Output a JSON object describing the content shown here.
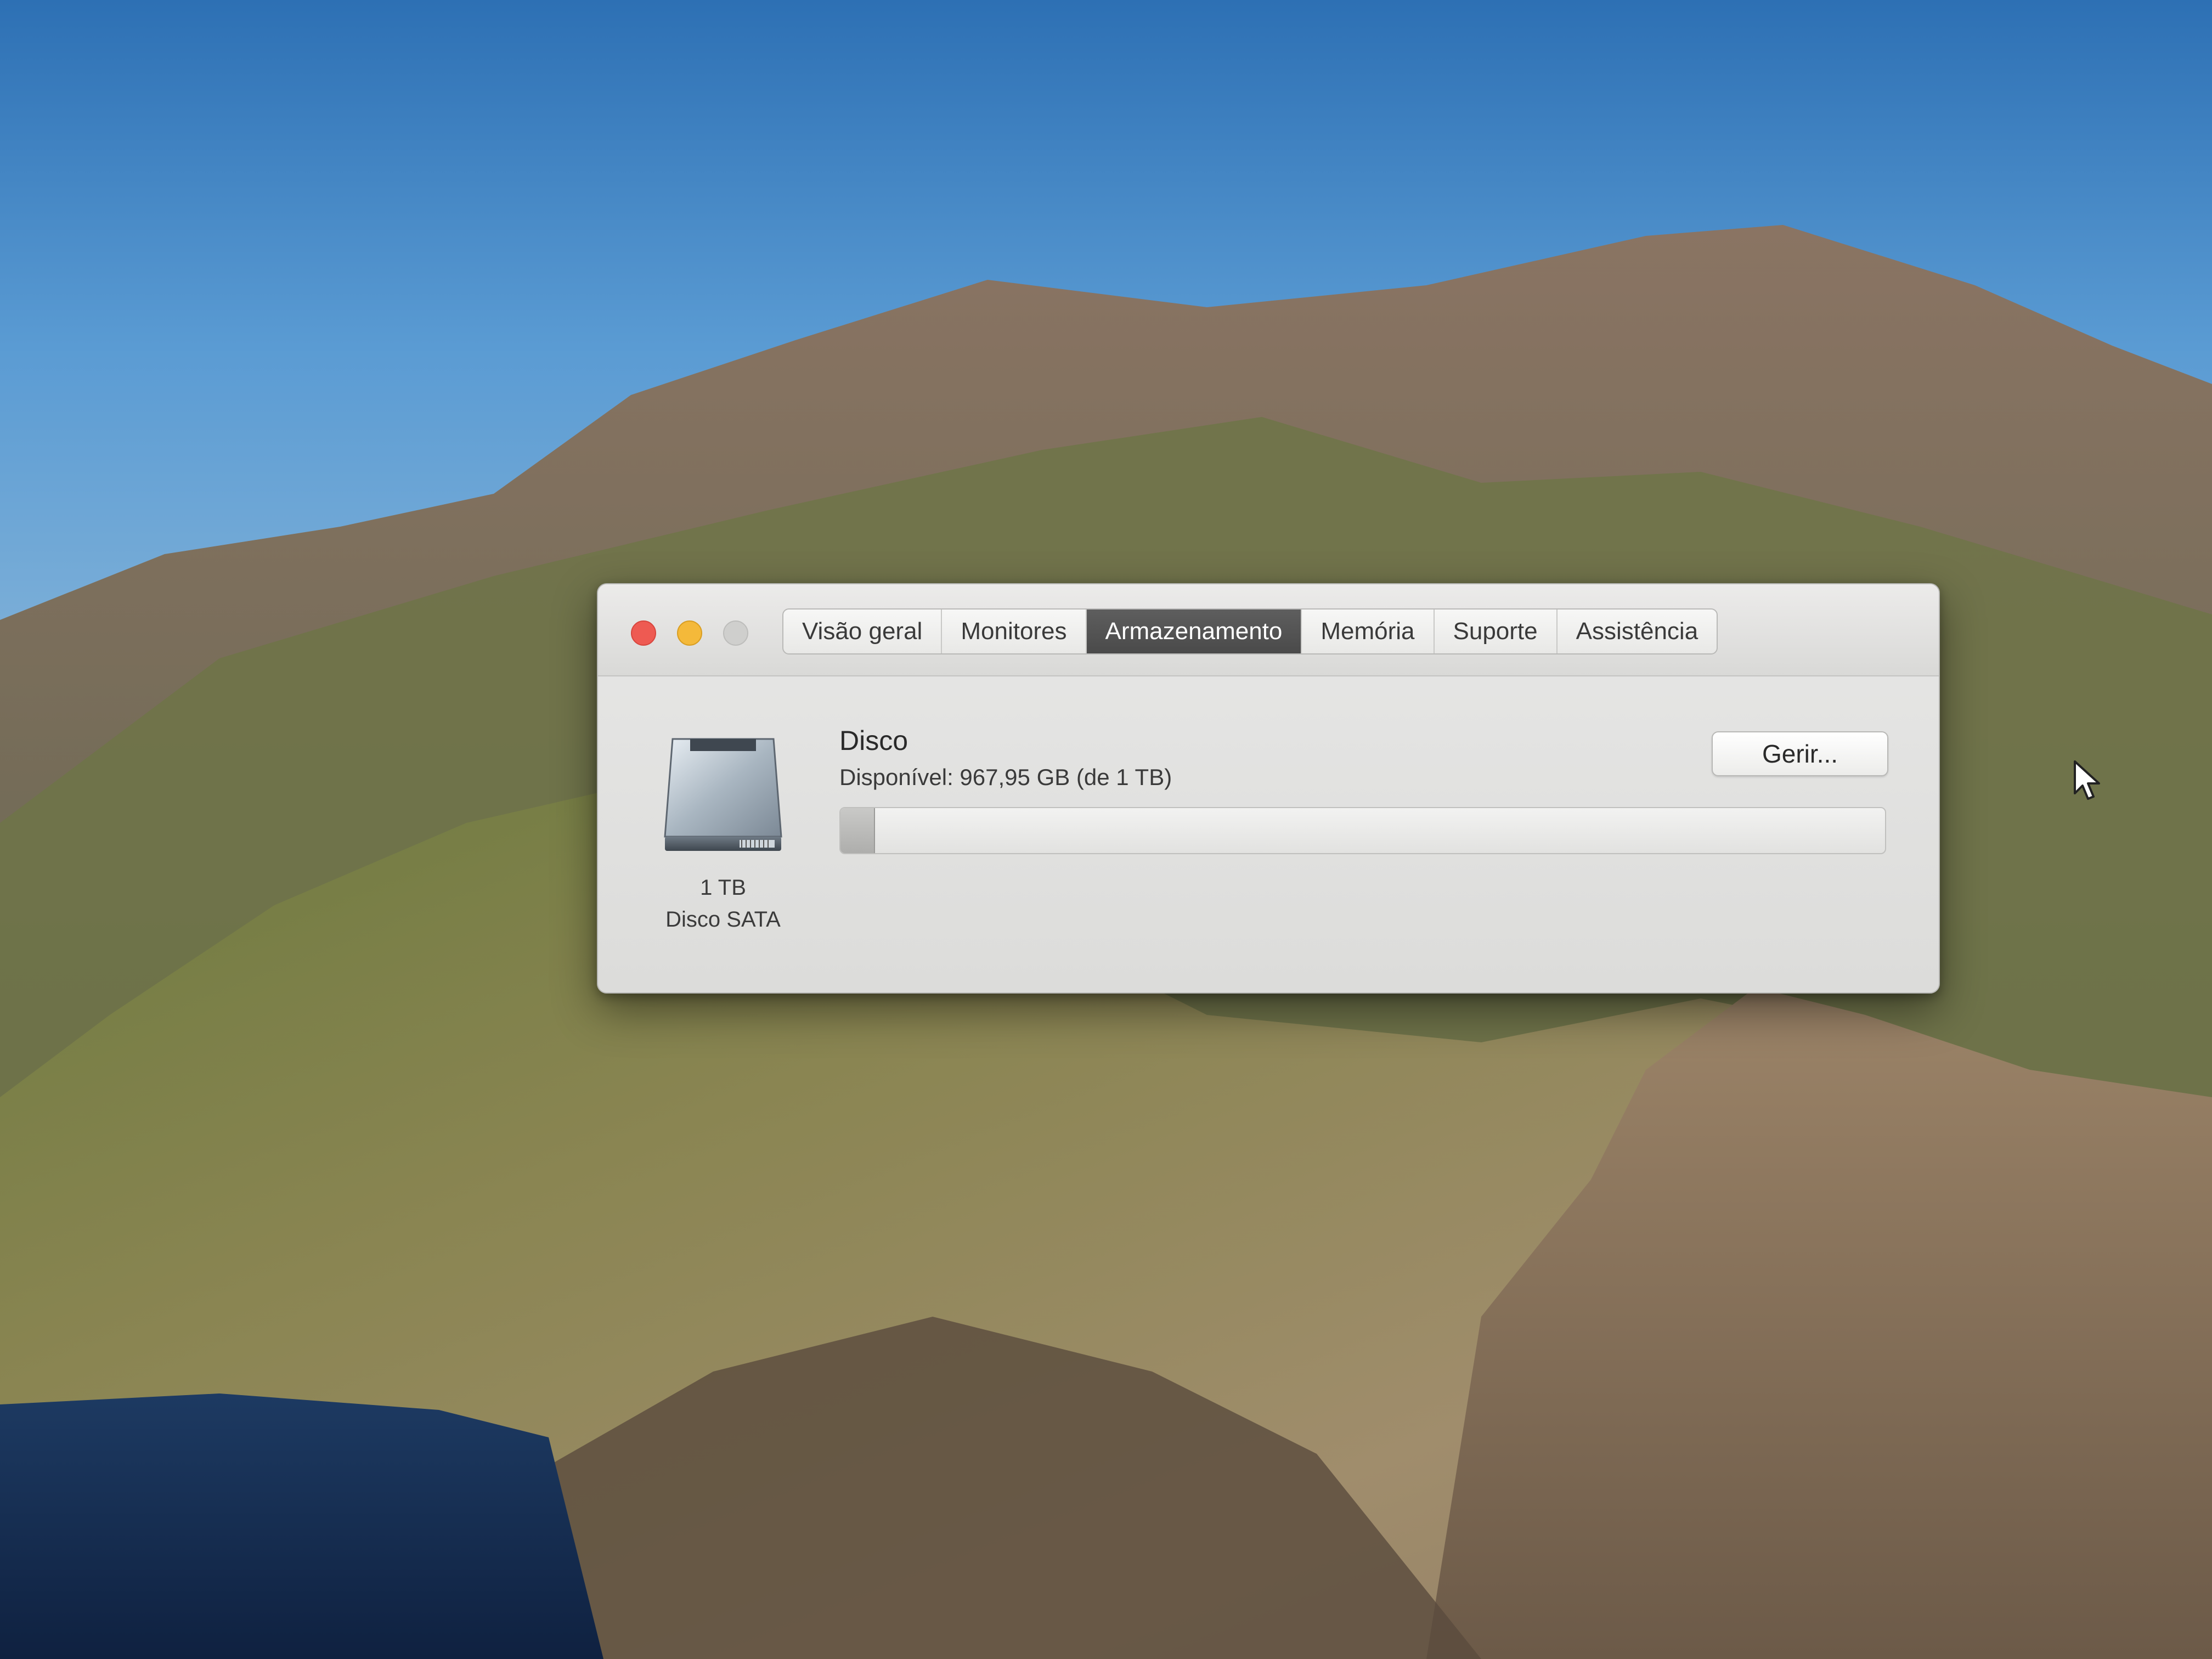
{
  "window": {
    "tabs": [
      {
        "label": "Visão geral",
        "selected": false
      },
      {
        "label": "Monitores",
        "selected": false
      },
      {
        "label": "Armazenamento",
        "selected": true
      },
      {
        "label": "Memória",
        "selected": false
      },
      {
        "label": "Suporte",
        "selected": false
      },
      {
        "label": "Assistência",
        "selected": false
      }
    ],
    "traffic_lights": {
      "close_color": "#ee5a52",
      "minimize_color": "#f4b93a",
      "zoom_color": "#cfcfcd"
    }
  },
  "storage": {
    "disk_icon": "hard-drive-icon",
    "capacity_label": "1 TB",
    "type_label": "Disco SATA",
    "name": "Disco",
    "available_text": "Disponível: 967,95 GB (de 1 TB)",
    "manage_label": "Gerir...",
    "used_fraction": 0.032
  }
}
